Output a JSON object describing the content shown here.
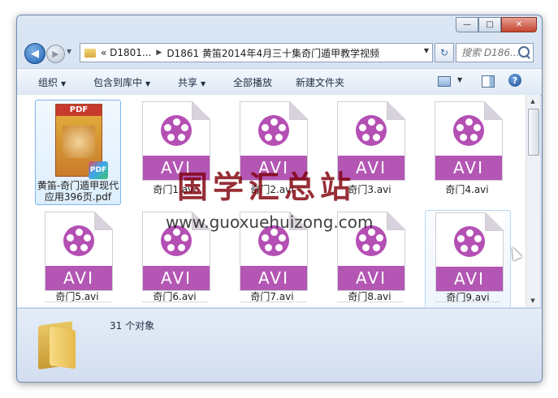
{
  "window": {
    "minimize": "—",
    "maximize": "□",
    "close": "✕"
  },
  "address": {
    "crumb_root": "« D1801...",
    "crumb_current": "D1861 黄笛2014年4月三十集奇门遁甲教学视频",
    "search_placeholder": "搜索 D186..."
  },
  "toolbar": {
    "organize": "组织",
    "include_in_library": "包含到库中",
    "share": "共享",
    "play_all": "全部播放",
    "new_folder": "新建文件夹"
  },
  "files": [
    {
      "name": "黄笛-奇门遁甲现代应用396页.pdf",
      "type": "pdf"
    },
    {
      "name": "奇门1.avi",
      "type": "avi"
    },
    {
      "name": "奇门2.avi",
      "type": "avi"
    },
    {
      "name": "奇门3.avi",
      "type": "avi"
    },
    {
      "name": "奇门4.avi",
      "type": "avi"
    },
    {
      "name": "奇门5.avi",
      "type": "avi"
    },
    {
      "name": "奇门6.avi",
      "type": "avi"
    },
    {
      "name": "奇门7.avi",
      "type": "avi"
    },
    {
      "name": "奇门8.avi",
      "type": "avi"
    },
    {
      "name": "奇门9.avi",
      "type": "avi"
    }
  ],
  "file_icon_labels": {
    "pdf_header": "PDF",
    "pdf_badge": "PDF",
    "avi_band": "AVI"
  },
  "status": {
    "count": "31 个对象"
  },
  "watermark": {
    "title": "国学汇总站",
    "url": "www.guoxuehuizong.com"
  }
}
